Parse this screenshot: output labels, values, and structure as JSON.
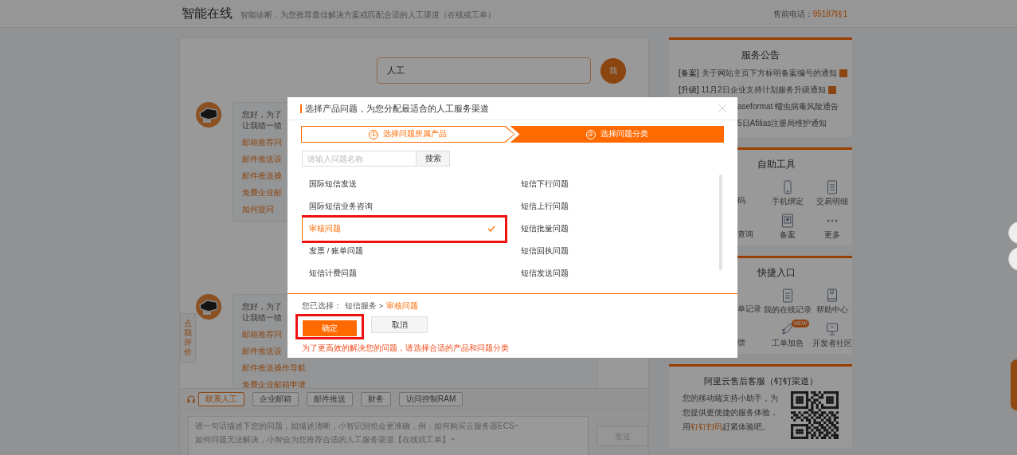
{
  "header": {
    "title": "智能在线",
    "subtitle": "智能诊断，为您推荐最佳解决方案或匹配合适的人工渠道（在线或工单）",
    "phone_label": "售前电话：",
    "phone": "95187转1"
  },
  "chat": {
    "messages": [
      {
        "kind": "user",
        "text": "人工",
        "avatar": "我"
      },
      {
        "kind": "bot",
        "lines": [
          "您好，为了",
          "让我猜一猜"
        ],
        "links": [
          {
            "text": "邮箱推荐问"
          },
          {
            "text": "邮件推送设"
          },
          {
            "text": "邮件推送操"
          },
          {
            "text": "免费企业邮"
          },
          {
            "text": "如何提问"
          }
        ]
      },
      {
        "kind": "bot",
        "lines": [
          "您好，为了",
          "让我猜一猜"
        ],
        "links": [
          {
            "text": "邮箱推荐问"
          },
          {
            "text": "邮件推送设"
          },
          {
            "text": "邮件推送操作导航"
          },
          {
            "text": "免费企业邮箱申请"
          }
        ]
      }
    ]
  },
  "rate_tab": "点我评价",
  "toolbar": {
    "contact": "联系人工",
    "tags": [
      "企业邮箱",
      "邮件推送",
      "财务",
      "访问控制RAM"
    ]
  },
  "input": {
    "placeholder": "请一句话描述下您的问题，如描述清晰，小智识别也会更准确，例：如何购买云服务器ECS~\n如何问题无法解决，小智会为您推荐合适的人工服务渠道【在线或工单】~",
    "send": "发送",
    "send_disabled": true
  },
  "sidebar": {
    "announcements": {
      "title": "服务公告",
      "items": [
        {
          "kind": "full",
          "tag": "[备案]",
          "text": "关于网站主页下方标明备案编号的通知",
          "new": true
        },
        {
          "kind": "full",
          "tag": "[升级]",
          "text": "11月2日企业支持计划服务升级通知",
          "new": true
        },
        {
          "kind": "partial",
          "text": "aseformat 蠕虫病毒风险通告"
        },
        {
          "kind": "partial",
          "text": "5日Afilias注册局维护通知"
        }
      ]
    },
    "tools": {
      "title": "自助工具",
      "items": [
        {
          "kind": "partial",
          "label": "码"
        },
        {
          "kind": "phone",
          "label": "手机绑定"
        },
        {
          "kind": "document",
          "label": "交易明细"
        },
        {
          "kind": "partial",
          "label": "查询"
        },
        {
          "kind": "certificate",
          "label": "备案"
        },
        {
          "kind": "dots",
          "label": "更多"
        }
      ]
    },
    "quick": {
      "title": "快捷入口",
      "items": [
        {
          "kind": "partial",
          "label": "单记录"
        },
        {
          "kind": "document",
          "label": "我的在线记录"
        },
        {
          "kind": "book",
          "label": "帮助中心"
        },
        {
          "kind": "partial",
          "label": "馈"
        },
        {
          "kind": "rocket",
          "label": "工单加急",
          "badge": "NEW"
        },
        {
          "kind": "monitor",
          "label": "开发者社区"
        }
      ]
    },
    "dingtalk": {
      "title": "阿里云售后客服（钉钉渠道）",
      "before": "您的移动端支持小助手，为您提供更便捷的服务体验，用",
      "link": "钉钉扫码",
      "after": "赶紧体验吧。"
    }
  },
  "modal": {
    "title": "选择产品问题，为您分配最适合的人工服务渠道",
    "steps": [
      {
        "number": "①",
        "label": "选择问题所属产品",
        "selected": false
      },
      {
        "number": "②",
        "label": "选择问题分类",
        "selected": true
      }
    ],
    "search": {
      "placeholder": "请输入问题名称",
      "button": "搜索"
    },
    "left_items": [
      {
        "text": "国际短信发送",
        "selected": false
      },
      {
        "text": "国际短信业务咨询",
        "selected": false
      },
      {
        "text": "审核问题",
        "selected": true
      },
      {
        "text": "发票 / 账单问题",
        "selected": false
      },
      {
        "text": "短信计费问题",
        "selected": false
      }
    ],
    "right_items": [
      {
        "text": "短信下行问题",
        "selected": false
      },
      {
        "text": "短信上行问题",
        "selected": false
      },
      {
        "text": "短信批量问题",
        "selected": false
      },
      {
        "text": "短信回执问题",
        "selected": false
      },
      {
        "text": "短信发送问题",
        "selected": false
      }
    ],
    "selection_label": "您已选择：",
    "selection_path": "短信服务 >",
    "selection_value": "审核问题",
    "confirm": "确定",
    "cancel": "取消",
    "warning": "为了更高效的解决您的问题，请选择合适的产品和问题分类"
  }
}
